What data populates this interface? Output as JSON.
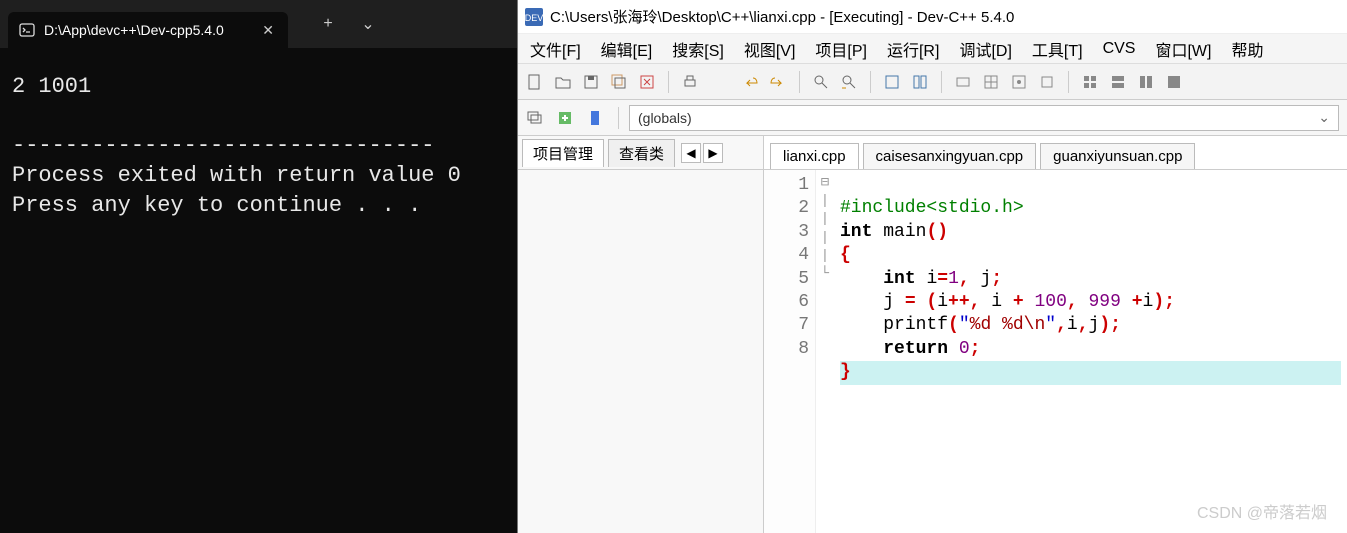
{
  "terminal": {
    "tab_title": "D:\\App\\devc++\\Dev-cpp5.4.0",
    "new_tab_glyph": "+",
    "dropdown_glyph": "⌄",
    "close_glyph": "✕",
    "output": "2 1001\n\n--------------------------------\nProcess exited with return value 0\nPress any key to continue . . ."
  },
  "devcpp": {
    "title": "C:\\Users\\张海玲\\Desktop\\C++\\lianxi.cpp - [Executing] - Dev-C++ 5.4.0",
    "menu": [
      "文件[F]",
      "编辑[E]",
      "搜索[S]",
      "视图[V]",
      "项目[P]",
      "运行[R]",
      "调试[D]",
      "工具[T]",
      "CVS",
      "窗口[W]",
      "帮助"
    ],
    "combo_value": "(globals)",
    "side_tabs": {
      "project": "项目管理",
      "classes": "查看类",
      "nav_prev": "◀",
      "nav_next": "▶"
    },
    "file_tabs": [
      "lianxi.cpp",
      "caisesanxingyuan.cpp",
      "guanxiyunsuan.cpp"
    ],
    "line_numbers": [
      "1",
      "2",
      "3",
      "4",
      "5",
      "6",
      "7",
      "8"
    ],
    "fold_markers": [
      "",
      "",
      "⊟",
      "|",
      "|",
      "|",
      "|",
      "└"
    ],
    "code": {
      "l1": {
        "pre": "#include<stdio.h>"
      },
      "l2": {
        "kw1": "int",
        "sp1": " ",
        "id": "main",
        "op1": "()"
      },
      "l3": {
        "br": "{"
      },
      "l4": {
        "indent": "    ",
        "kw": "int",
        "sp": " ",
        "txt": "i",
        "op1": "=",
        "num1": "1",
        "comma": ", ",
        "txt2": "j",
        "semi": ";"
      },
      "l5": {
        "indent": "    ",
        "lhs": "j ",
        "op1": "= (",
        "id": "i",
        "op2": "++, ",
        "id2": "i ",
        "op3": "+ ",
        "num1": "100",
        "comma": ", ",
        "num2": "999",
        " sp": " ",
        "op4": "+",
        "id3": "i",
        "op5": ");"
      },
      "l6": {
        "indent": "    ",
        "fn": "printf",
        "op1": "(",
        "str": "\"",
        "fmt": "%d %d",
        "esc": "\\n",
        "strend": "\"",
        "op2": ",",
        "args": "i",
        "op3": ",",
        "args2": "j",
        "op4": ");"
      },
      "l7": {
        "indent": "    ",
        "kw": "return",
        "sp": " ",
        "num": "0",
        "semi": ";"
      },
      "l8": {
        "br": "}"
      }
    }
  },
  "watermark": "CSDN @帝落若烟"
}
